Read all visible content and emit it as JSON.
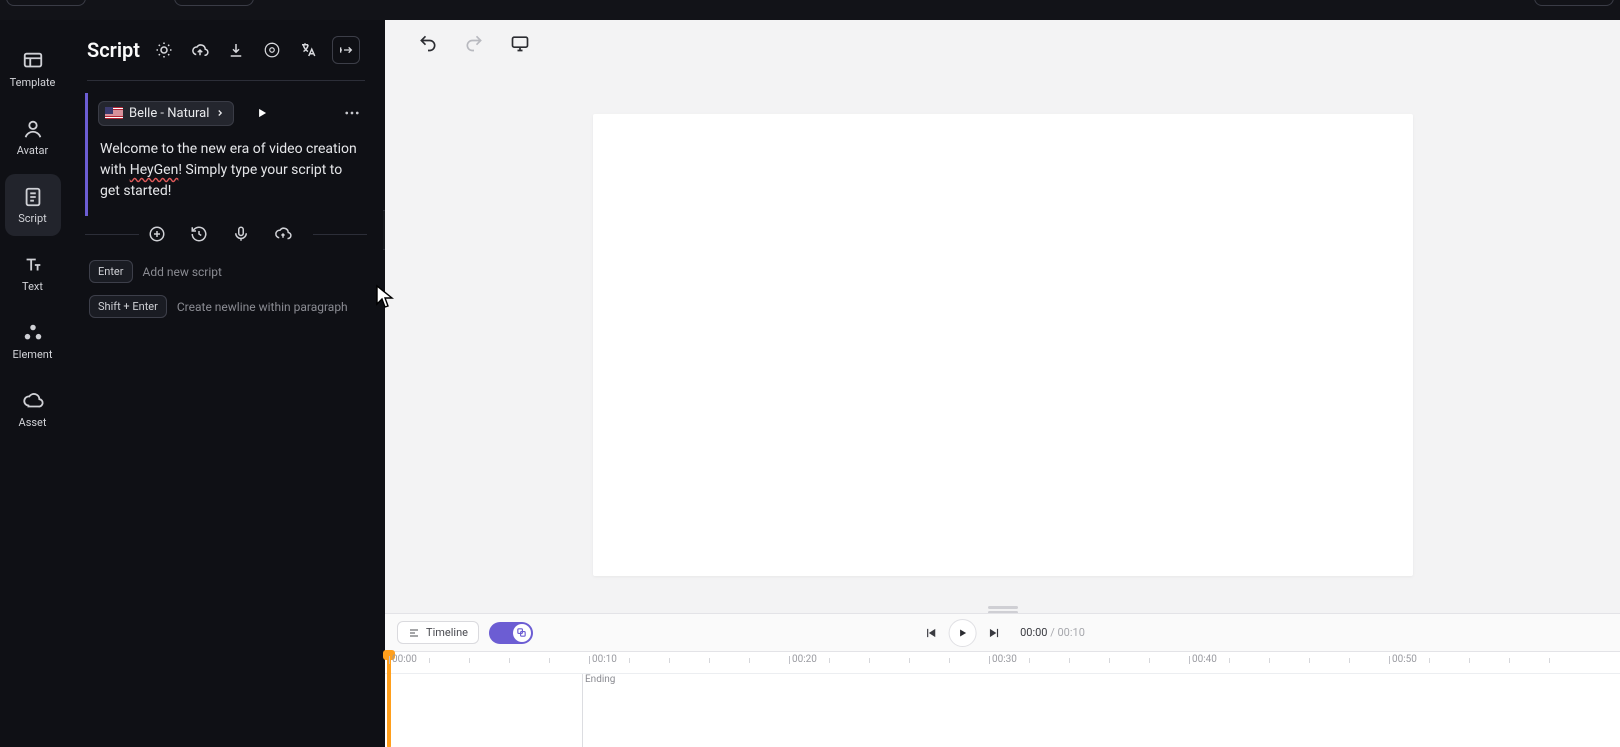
{
  "rail": {
    "template": "Template",
    "avatar": "Avatar",
    "script": "Script",
    "text": "Text",
    "element": "Element",
    "asset": "Asset"
  },
  "script_panel": {
    "title": "Script",
    "voice_name": "Belle - Natural",
    "script_pre": "Welcome to the new era of video creation with ",
    "script_brand": "HeyGen",
    "script_post": "! Simply type your script to get started!",
    "hint_enter_key": "Enter",
    "hint_enter_text": "Add new script",
    "hint_shift_key": "Shift + Enter",
    "hint_shift_text": "Create newline within paragraph"
  },
  "timeline": {
    "chip_label": "Timeline",
    "current": "00:00",
    "sep": " / ",
    "total": "00:10",
    "marks": [
      "00:00",
      "00:10",
      "00:20",
      "00:30",
      "00:40",
      "00:50"
    ],
    "block_label": "Ending"
  }
}
